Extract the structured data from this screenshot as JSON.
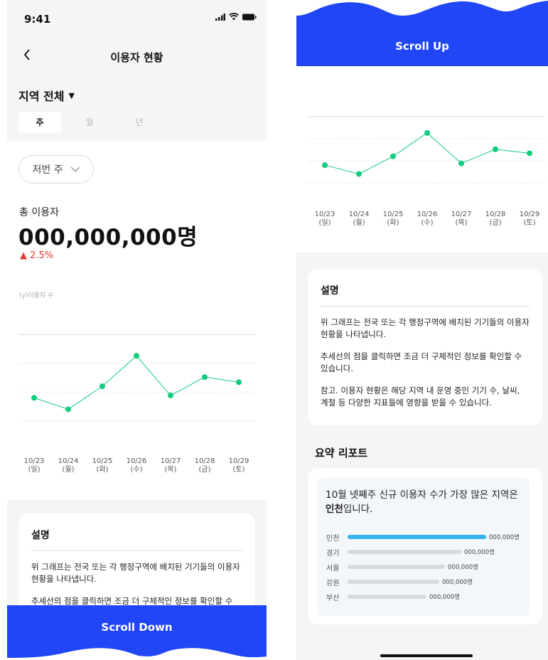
{
  "colors": {
    "accent": "#2046f5",
    "line": "#12cc7e",
    "up": "#e8392e",
    "bar_top": "#36b3f0"
  },
  "status_bar": {
    "time": "9:41"
  },
  "nav": {
    "back_icon": "chevron-left-icon",
    "title": "이용자 현황"
  },
  "filter": {
    "region_label": "지역 전체",
    "tabs": [
      "주",
      "월",
      "년"
    ],
    "active_tab": "주",
    "period_label": "저번 주"
  },
  "total": {
    "label": "총 이용자",
    "value": "000,000,000명",
    "change": "2.5%"
  },
  "chart_data": {
    "type": "line",
    "ylabel": "(y)이용자 수",
    "categories": [
      "10/23 (일)",
      "10/24 (월)",
      "10/25 (화)",
      "10/26 (수)",
      "10/27 (목)",
      "10/28 (금)",
      "10/29 (토)"
    ],
    "x_dates": [
      "10/23",
      "10/24",
      "10/25",
      "10/26",
      "10/27",
      "10/28",
      "10/29"
    ],
    "x_days": [
      "(일)",
      "(월)",
      "(화)",
      "(수)",
      "(목)",
      "(금)",
      "(토)"
    ],
    "values": [
      40,
      20,
      60,
      113,
      44,
      76,
      67
    ],
    "ylim": [
      -50,
      200
    ],
    "grid": true
  },
  "description": {
    "title": "설명",
    "p1": "위 그래프는 전국 또는 각 행정구역에 배치된 기기들의 이용자 현황을 나타냅니다.",
    "p2": "추세선의 점을 클릭하면 조금 더 구체적인 정보를 확인할 수 있습니다.",
    "p3": "참고. 이용자 현황은 해당 지역 내 운영 중인 기기 수, 날씨, 계절 등 다양한 지표들에 영향을 받을 수 있습니다."
  },
  "buttons": {
    "scroll_down": "Scroll Down",
    "scroll_up": "Scroll Up"
  },
  "summary": {
    "title": "요약 리포트",
    "text_pre": "10월 넷째주 신규 이용자 수가 가장 많은 지역은 ",
    "highlight": "인천",
    "text_post": "입니다.",
    "bars": [
      {
        "name": "인천",
        "value": "000,000명",
        "ratio": 1.0
      },
      {
        "name": "경기",
        "value": "000,000명",
        "ratio": 0.82
      },
      {
        "name": "서울",
        "value": "000,000명",
        "ratio": 0.7
      },
      {
        "name": "강원",
        "value": "000,000명",
        "ratio": 0.66
      },
      {
        "name": "부산",
        "value": "000,000명",
        "ratio": 0.57
      }
    ]
  }
}
